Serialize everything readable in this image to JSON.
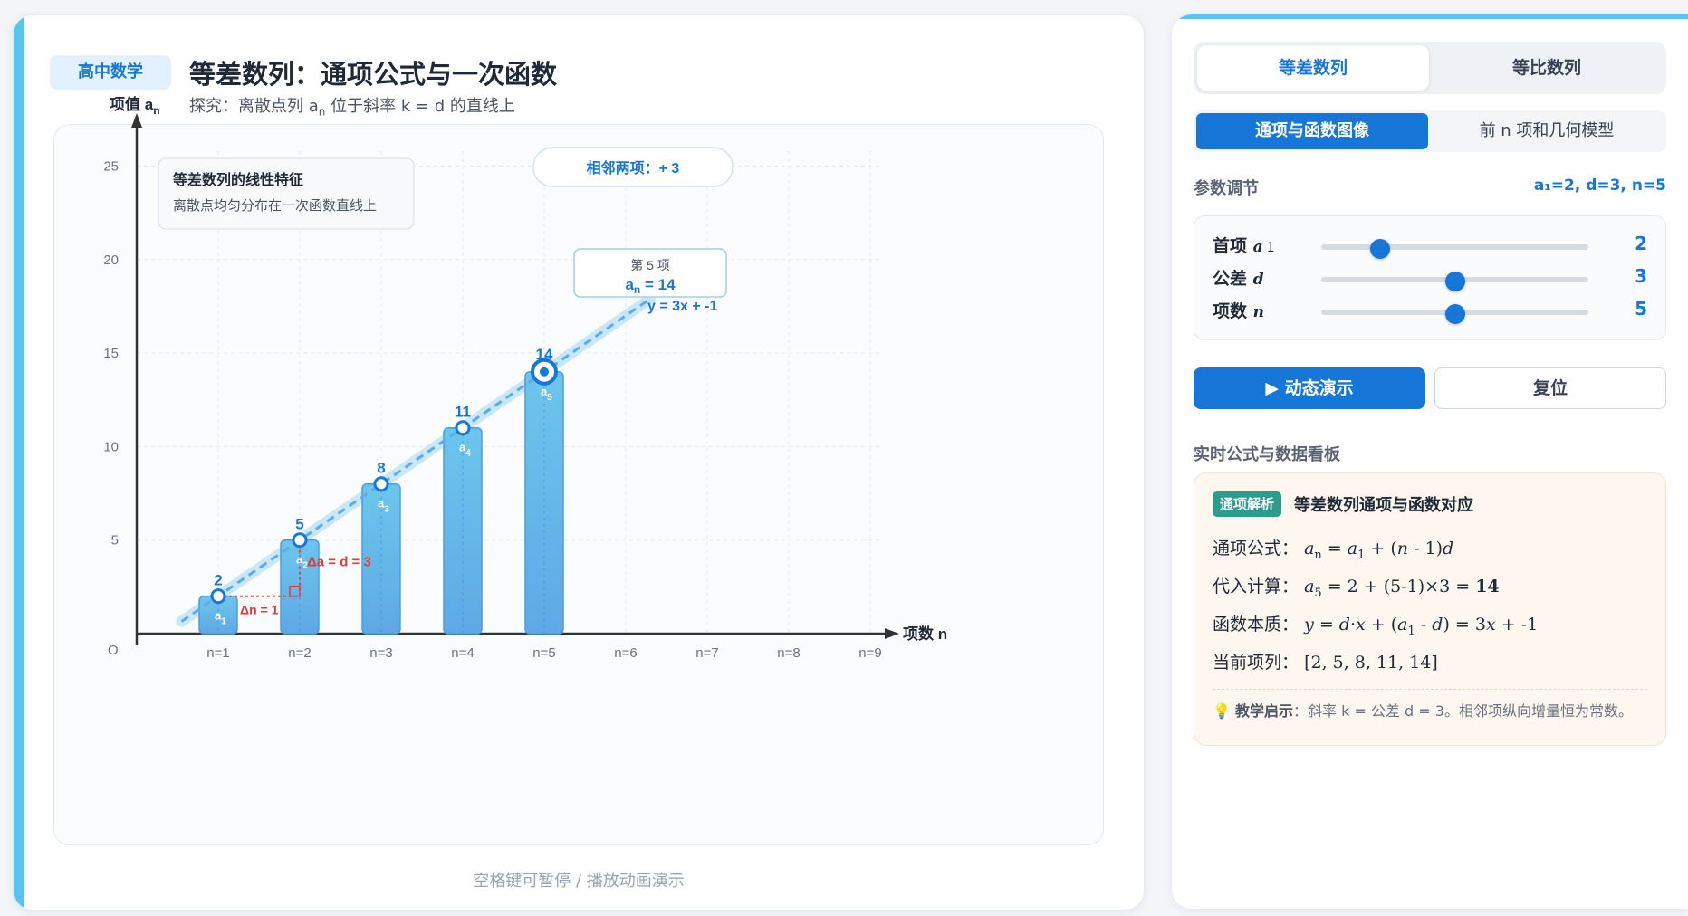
{
  "header": {
    "badge": "高中数学",
    "title": "等差数列：通项公式与一次函数",
    "subtitle_prefix": "探究：离散点列 a",
    "subtitle_sub": "n",
    "subtitle_suffix": " 位于斜率 k = d 的直线上"
  },
  "footer_hint": "空格键可暂停 / 播放动画演示",
  "tabs_top": [
    {
      "label": "等差数列",
      "active": true
    },
    {
      "label": "等比数列",
      "active": false
    }
  ],
  "tabs_sub": [
    {
      "label": "通项与函数图像",
      "active": true
    },
    {
      "label": "前 n 项和几何模型",
      "active": false
    }
  ],
  "params": {
    "section_label": "参数调节",
    "readout": "a₁=2, d=3, n=5",
    "rows": [
      {
        "label": "首项",
        "symbol": "a",
        "sub": "1",
        "value": "2",
        "position": 0.22
      },
      {
        "label": "公差",
        "symbol": "d",
        "sub": "",
        "value": "3",
        "position": 0.5
      },
      {
        "label": "项数",
        "symbol": "n",
        "sub": "",
        "value": "5",
        "position": 0.5
      }
    ]
  },
  "buttons": {
    "play": "▶ 动态演示",
    "reset": "复位"
  },
  "dashboard": {
    "section_label": "实时公式与数据看板",
    "badge": "通项解析",
    "title": "等差数列通项与函数对应",
    "general_label": "通项公式：",
    "substitute_label": "代入计算：",
    "function_label": "函数本质：",
    "terms_label": "当前项列：",
    "terms_value": "[2, 5, 8, 11, 14]",
    "tip_label": "教学启示",
    "tip_text": "：斜率 k = 公差 d = 3。相邻项纵向增量恒为常数。"
  },
  "colors": {
    "accent": "#1677d9",
    "bar": "#64bce8",
    "delta": "#e53935",
    "teal_badge": "#2a9d8f"
  },
  "chart_data": {
    "type": "bar",
    "ylabel": "项值 a",
    "ylabel_sub": "n",
    "xlabel": "项数 n",
    "origin_label": "O",
    "categories": [
      "n=1",
      "n=2",
      "n=3",
      "n=4",
      "n=5",
      "n=6",
      "n=7",
      "n=8",
      "n=9"
    ],
    "values": [
      2,
      5,
      8,
      11,
      14
    ],
    "term_names": [
      "a1",
      "a2",
      "a3",
      "a4",
      "a5"
    ],
    "yticks": [
      5,
      10,
      15,
      20,
      25
    ],
    "ylim": [
      0,
      27
    ],
    "line": {
      "slope": 3,
      "intercept": -1,
      "label": "y = 3x + -1"
    },
    "highlight_index": 4,
    "info_box": {
      "title": "等差数列的线性特征",
      "text": "离散点均匀分布在一次函数直线上"
    },
    "diff_badge": "相邻两项：+ 3",
    "tooltip": {
      "title": "第 5 项",
      "value": "a",
      "value_sub": "n",
      "value_suffix": " = 14"
    },
    "delta_n_label": "Δn = 1",
    "delta_a_label": "Δa = d = 3",
    "grid": true
  }
}
